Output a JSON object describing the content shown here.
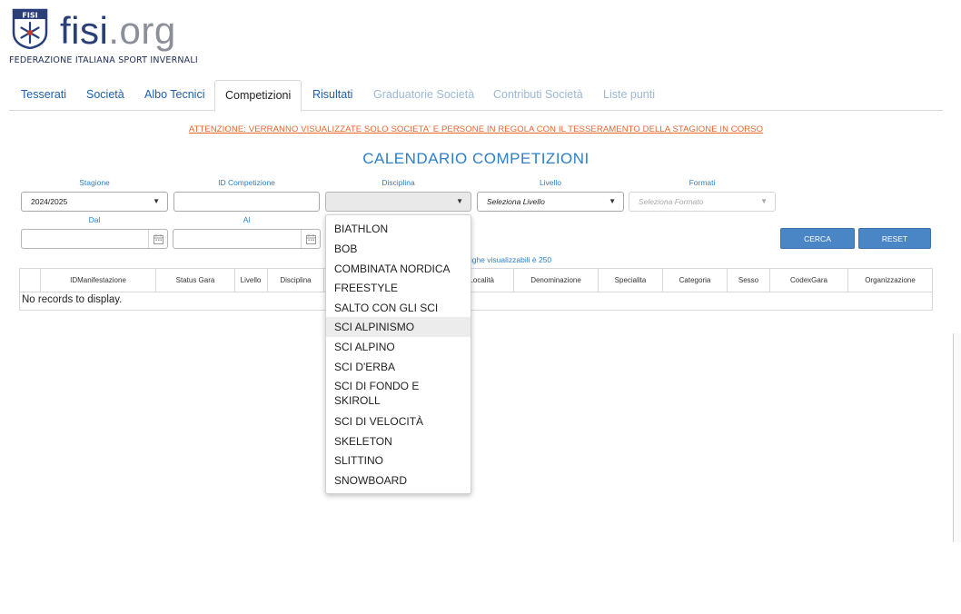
{
  "logo": {
    "wordmark_main": "fisi",
    "wordmark_suffix": ".org",
    "subtitle": "FEDERAZIONE ITALIANA SPORT INVERNALI",
    "emblem_text": "FISI"
  },
  "tabs": [
    {
      "label": "Tesserati",
      "state": "enabled"
    },
    {
      "label": "Società",
      "state": "enabled"
    },
    {
      "label": "Albo Tecnici",
      "state": "enabled"
    },
    {
      "label": "Competizioni",
      "state": "active"
    },
    {
      "label": "Risultati",
      "state": "enabled"
    },
    {
      "label": "Graduatorie Società",
      "state": "disabled"
    },
    {
      "label": "Contributi Società",
      "state": "disabled"
    },
    {
      "label": "Liste punti",
      "state": "disabled"
    }
  ],
  "notice": "ATTENZIONE: VERRANNO VISUALIZZATE SOLO SOCIETA' E PERSONE IN REGOLA CON IL TESSERAMENTO DELLA STAGIONE IN CORSO",
  "page_title": "CALENDARIO COMPETIZIONI",
  "filters": {
    "stagione": {
      "label": "Stagione",
      "value": "2024/2025"
    },
    "id_competizione": {
      "label": "ID Competizione",
      "value": ""
    },
    "disciplina": {
      "label": "Disciplina",
      "value": ""
    },
    "livello": {
      "label": "Livello",
      "placeholder": "Seleziona Livello"
    },
    "formati": {
      "label": "Formati",
      "placeholder": "Seleziona Formato"
    },
    "dal": {
      "label": "Dal",
      "value": ""
    },
    "al": {
      "label": "Al",
      "value": ""
    }
  },
  "buttons": {
    "search": "CERCA",
    "reset": "RESET"
  },
  "rows_info": "righe visualizzabili è 250",
  "grid": {
    "columns": [
      "IDManifestazione",
      "Status Gara",
      "Livello",
      "Disciplina",
      "Località",
      "Denominazione",
      "Specialita",
      "Categoria",
      "Sesso",
      "CodexGara",
      "Organizzazione"
    ],
    "empty_message": "No records to display."
  },
  "disciplina_options": [
    "BIATHLON",
    "BOB",
    "COMBINATA NORDICA",
    "FREESTYLE",
    "SALTO CON GLI SCI",
    "SCI ALPINISMO",
    "SCI ALPINO",
    "SCI D'ERBA",
    "SCI DI FONDO E SKIROLL",
    "SCI DI VELOCITÀ",
    "SKELETON",
    "SLITTINO",
    "SNOWBOARD"
  ],
  "highlighted_option": "SCI ALPINISMO",
  "colors": {
    "accent": "#2e7fc7",
    "link": "#1d5fa8",
    "warning": "#e8652d",
    "button": "#4a86c5",
    "brand": "#2a3f7a"
  }
}
